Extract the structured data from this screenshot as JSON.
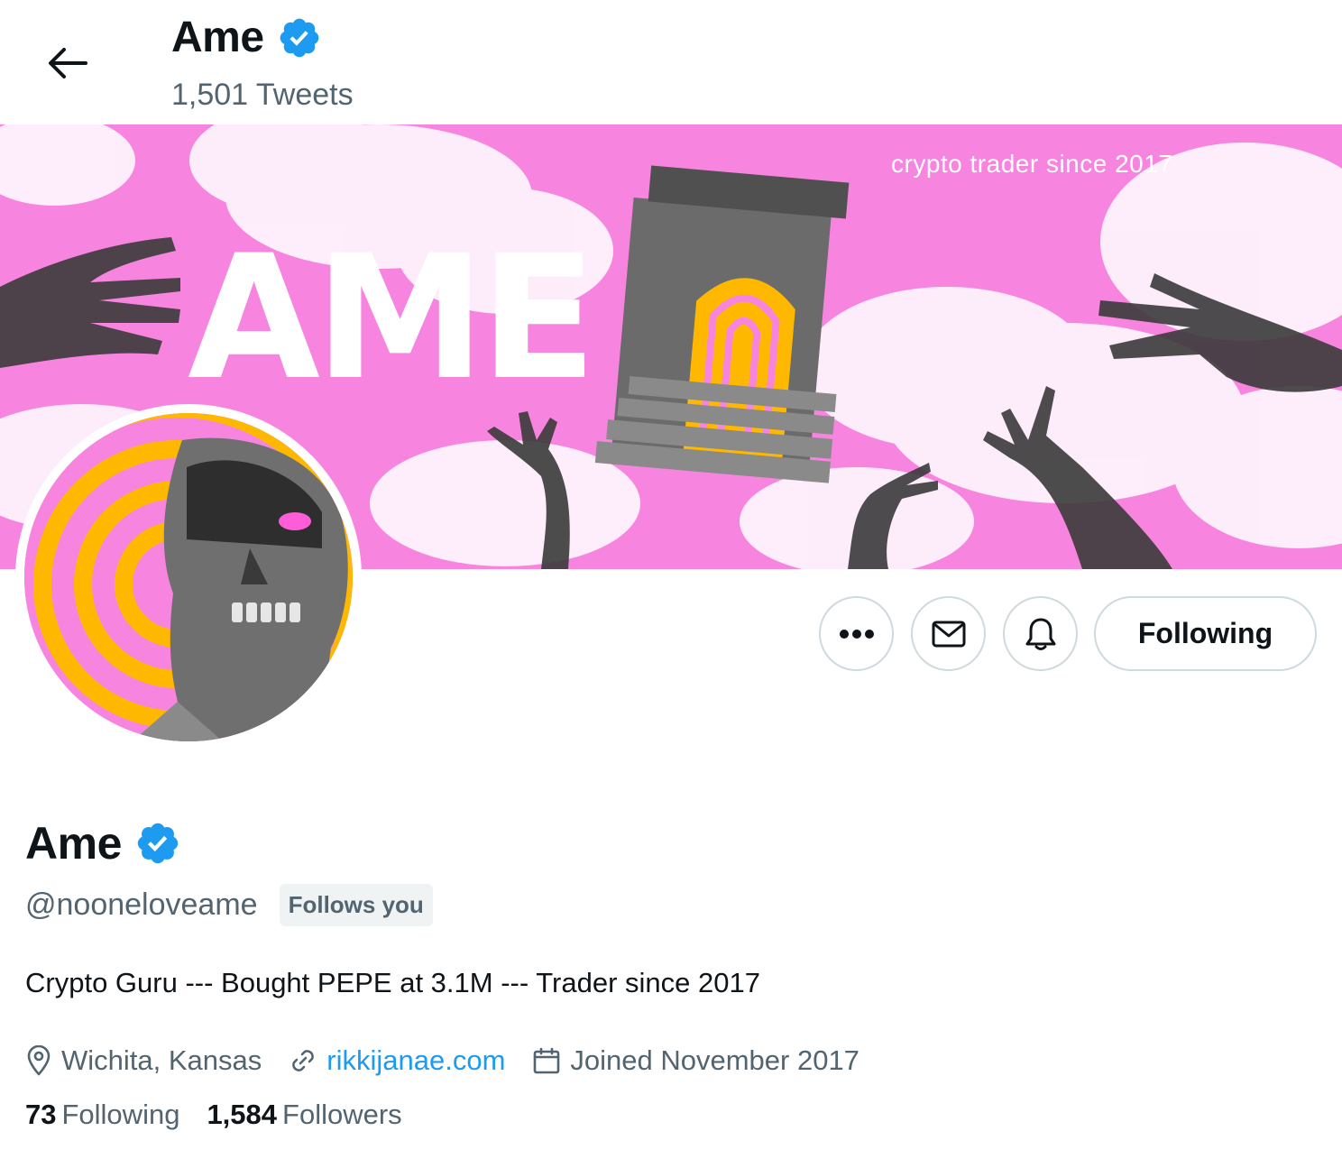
{
  "header": {
    "name": "Ame",
    "tweet_count": "1,501 Tweets"
  },
  "banner": {
    "tagline": "crypto trader since 2017",
    "big_word": "AME"
  },
  "actions": {
    "following_label": "Following"
  },
  "profile": {
    "name": "Ame",
    "handle": "@nooneloveame",
    "follows_you": "Follows you",
    "bio": "Crypto Guru --- Bought PEPE at 3.1M --- Trader since 2017",
    "location": "Wichita, Kansas",
    "website": "rikkijanae.com",
    "joined": "Joined November 2017"
  },
  "stats": {
    "following_count": "73",
    "following_label": "Following",
    "followers_count": "1,584",
    "followers_label": "Followers"
  },
  "colors": {
    "accent": "#1d9bf0",
    "verified": "#1d9bf0",
    "banner_pink": "#f785df",
    "banner_yellow": "#ffb800",
    "muted_text": "#536471"
  },
  "icons": [
    "back-arrow-icon",
    "verified-badge-icon",
    "more-icon",
    "mail-icon",
    "bell-icon",
    "location-pin-icon",
    "link-icon",
    "calendar-icon"
  ]
}
